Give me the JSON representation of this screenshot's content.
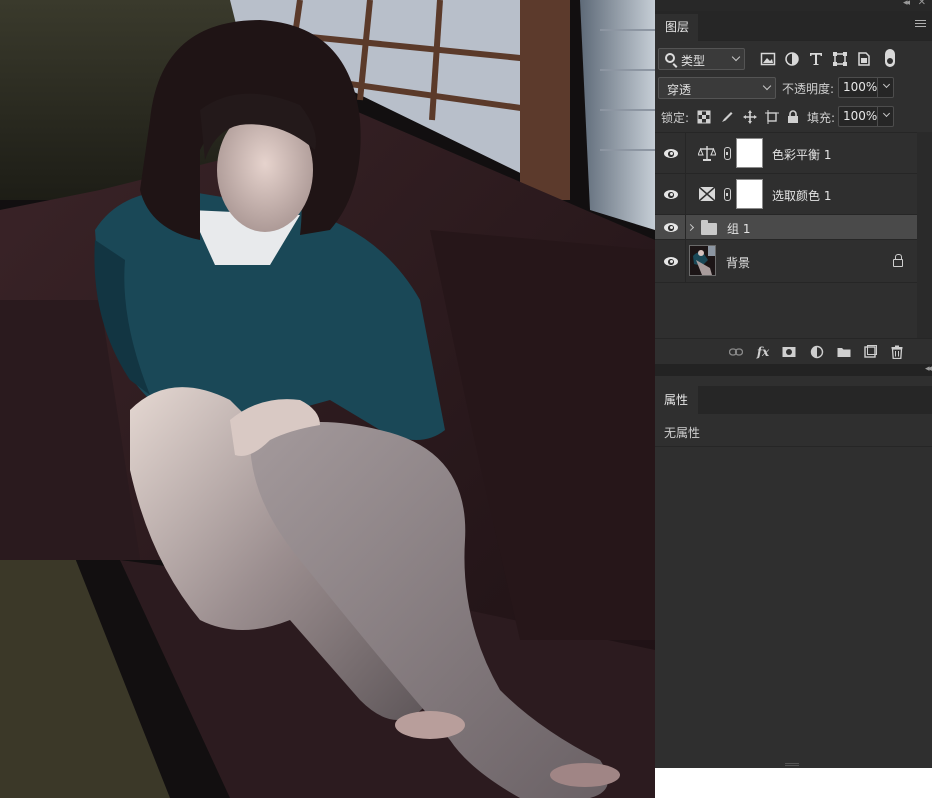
{
  "layers_panel": {
    "tab": "图层",
    "filter_kind": "类型",
    "blend_mode": "穿透",
    "opacity_label": "不透明度:",
    "opacity_value": "100%",
    "lock_label": "锁定:",
    "fill_label": "填充:",
    "fill_value": "100%",
    "layers": [
      {
        "name": "色彩平衡 1",
        "type": "adjustment",
        "icon": "color-balance-icon",
        "visible": true,
        "selected": false
      },
      {
        "name": "选取颜色 1",
        "type": "adjustment",
        "icon": "selective-color-icon",
        "visible": true,
        "selected": false
      },
      {
        "name": "组 1",
        "type": "group",
        "icon": "folder-icon",
        "visible": true,
        "selected": true
      },
      {
        "name": "背景",
        "type": "background",
        "icon": "lock-icon",
        "visible": true,
        "selected": false
      }
    ]
  },
  "properties_panel": {
    "tab": "属性",
    "empty_text": "无属性"
  },
  "colors": {
    "panel_bg": "#2f2f2f",
    "selected_row": "#4a4a4a",
    "canvas_dark": "#0e0c0d"
  }
}
